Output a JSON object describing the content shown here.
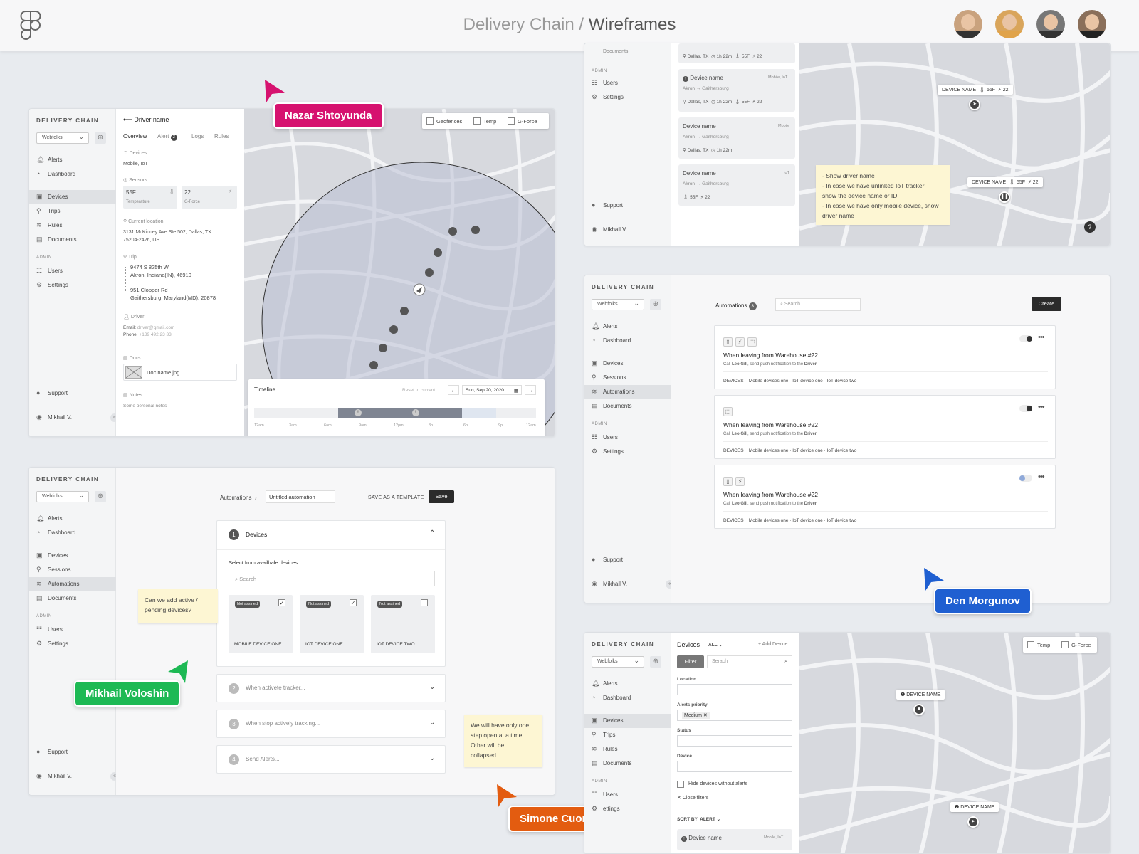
{
  "header": {
    "project": "Delivery Chain",
    "separator": " / ",
    "page": "Wireframes",
    "collaborator_colors": [
      "#1db954",
      "#d6126f",
      "#1f5fd1",
      "#e35c10"
    ]
  },
  "cursors": {
    "nazar": "Nazar Shtoyunda",
    "den": "Den Morgunov",
    "mikhail": "Mikhail Voloshin",
    "simone": "Simone Cuomo"
  },
  "app": {
    "logo": "DELIVERY CHAIN",
    "workspace": "Webfolks",
    "admin": "ADMIN",
    "support": "Support",
    "user": "Mikhail V.",
    "nav": {
      "alerts": "Alerts",
      "dashboard": "Dashboard",
      "devices": "Devices",
      "trips": "Trips",
      "rules": "Rules",
      "documents": "Documents",
      "sessions": "Sessions",
      "automations": "Automations",
      "users": "Users",
      "settings": "Settings"
    }
  },
  "driver": {
    "back_title": "Driver name",
    "tabs": [
      "Overview",
      "Alert",
      "Logs",
      "Rules"
    ],
    "alert_count": "2",
    "devices_label": "Devices",
    "devices_value": "Mobile, IoT",
    "sensors_label": "Sensors",
    "temp_value": "55F",
    "temp_label": "Temperature",
    "g_value": "22",
    "g_label": "G-Force",
    "location_label": "Current location",
    "location_1": "3131 McKinney Ave Ste 502, Dallas, TX",
    "location_2": "75204-2426, US",
    "trip_label": "Trip",
    "trip_a1": "9474 S 825th W",
    "trip_a2": "Akron, Indiana(IN), 46910",
    "trip_b1": "951 Clopper Rd",
    "trip_b2": "Gaithersburg, Maryland(MD), 20878",
    "driver_label": "Driver",
    "email_label": "Email:",
    "email": "driver@gmail.com",
    "phone_label": "Phone:",
    "phone": "+139 492 23 33",
    "docs_label": "Docs",
    "doc_name": "Doc name.jpg",
    "notes_label": "Notes",
    "notes_value": "Some personal notes",
    "filters": [
      "Geofences",
      "Temp",
      "G-Force"
    ],
    "timeline": {
      "title": "Timeline",
      "reset": "Reset to current",
      "date": "Sun, Sep 20, 2020",
      "ticks": [
        "12am",
        "3am",
        "6am",
        "9am",
        "12pm",
        "3p",
        "6p",
        "9p",
        "12am"
      ]
    }
  },
  "devlist": {
    "items": [
      {
        "name": "",
        "from": "",
        "to": "",
        "loc": "Dallas, TX",
        "dur": "1h 22m",
        "temp": "55F",
        "g": "22"
      },
      {
        "name": "Device name",
        "type": "Mobile, IoT",
        "from": "Akron",
        "to": "Gaithersburg",
        "loc": "Dallas, TX",
        "dur": "1h 22m",
        "temp": "55F",
        "g": "22"
      },
      {
        "name": "Device name",
        "type": "Mobile",
        "from": "Akron",
        "to": "Gaithersburg",
        "loc": "Dallas, TX",
        "dur": "1h 22m"
      },
      {
        "name": "Device name",
        "type": "IoT",
        "from": "Akron",
        "to": "Gaithersburg",
        "temp": "55F",
        "g": "22"
      }
    ],
    "badge_device": "DEVICE NAME",
    "badge_temp": "55F",
    "badge_g": "22",
    "doc_cut": "Documents",
    "note": [
      "- Show driver name",
      "- In case we have unlinked IoT tracker",
      "show the device name or ID",
      "- In case we have only mobile device, show",
      "driver name"
    ]
  },
  "automations": {
    "title": "Automations",
    "count": "3",
    "search": "Search",
    "create": "Create",
    "rule_title": "When leaving from Warehouse #22",
    "rule_desc_a": "Call ",
    "rule_desc_b": "Leo Gill",
    "rule_desc_c": ", send push notification to the ",
    "rule_desc_d": "Driver",
    "devices_label": "DEVICES",
    "dev_items": [
      "Mobile devices one",
      "IoT device one",
      "IoT device two"
    ]
  },
  "editor": {
    "crumb": "Automations",
    "name": "Untitled automation",
    "template": "SAVE AS A TEMPLATE",
    "save": "Save",
    "step1": "Devices",
    "select_label": "Select from availbale devices",
    "search": "Search",
    "devices": [
      {
        "badge": "Not assined",
        "name": "MOBILE DEVICE ONE",
        "checked": "✓"
      },
      {
        "badge": "Not assined",
        "name": "IOT DEVICE ONE",
        "checked": "✓"
      },
      {
        "badge": "Not assined",
        "name": "IOT DEVICE TWO",
        "checked": ""
      }
    ],
    "step2": "When activete tracker...",
    "step3": "When stop actively tracking...",
    "step4": "Send Alerts...",
    "note1": [
      "Can we add active /",
      "pending devices?"
    ],
    "note2": [
      "We will have only one",
      "step open at a time.",
      "Other will be",
      "collapsed"
    ]
  },
  "devfilter": {
    "title": "Devices",
    "all": "ALL",
    "add": "+ Add Device",
    "filter": "Filter",
    "search": "Serach",
    "location": "Location",
    "priority": "Alerts priority",
    "priority_value": "Medium",
    "status": "Status",
    "device": "Device",
    "hide": "Hide devices without alerts",
    "close": "Close filters",
    "sort": "SORT BY: ALERT",
    "item_name": "Device name",
    "item_type": "Mobile, IoT",
    "map_filters": [
      "Temp",
      "G-Force"
    ],
    "badge": "DEVICE NAME",
    "settings_cut": "ettings"
  }
}
